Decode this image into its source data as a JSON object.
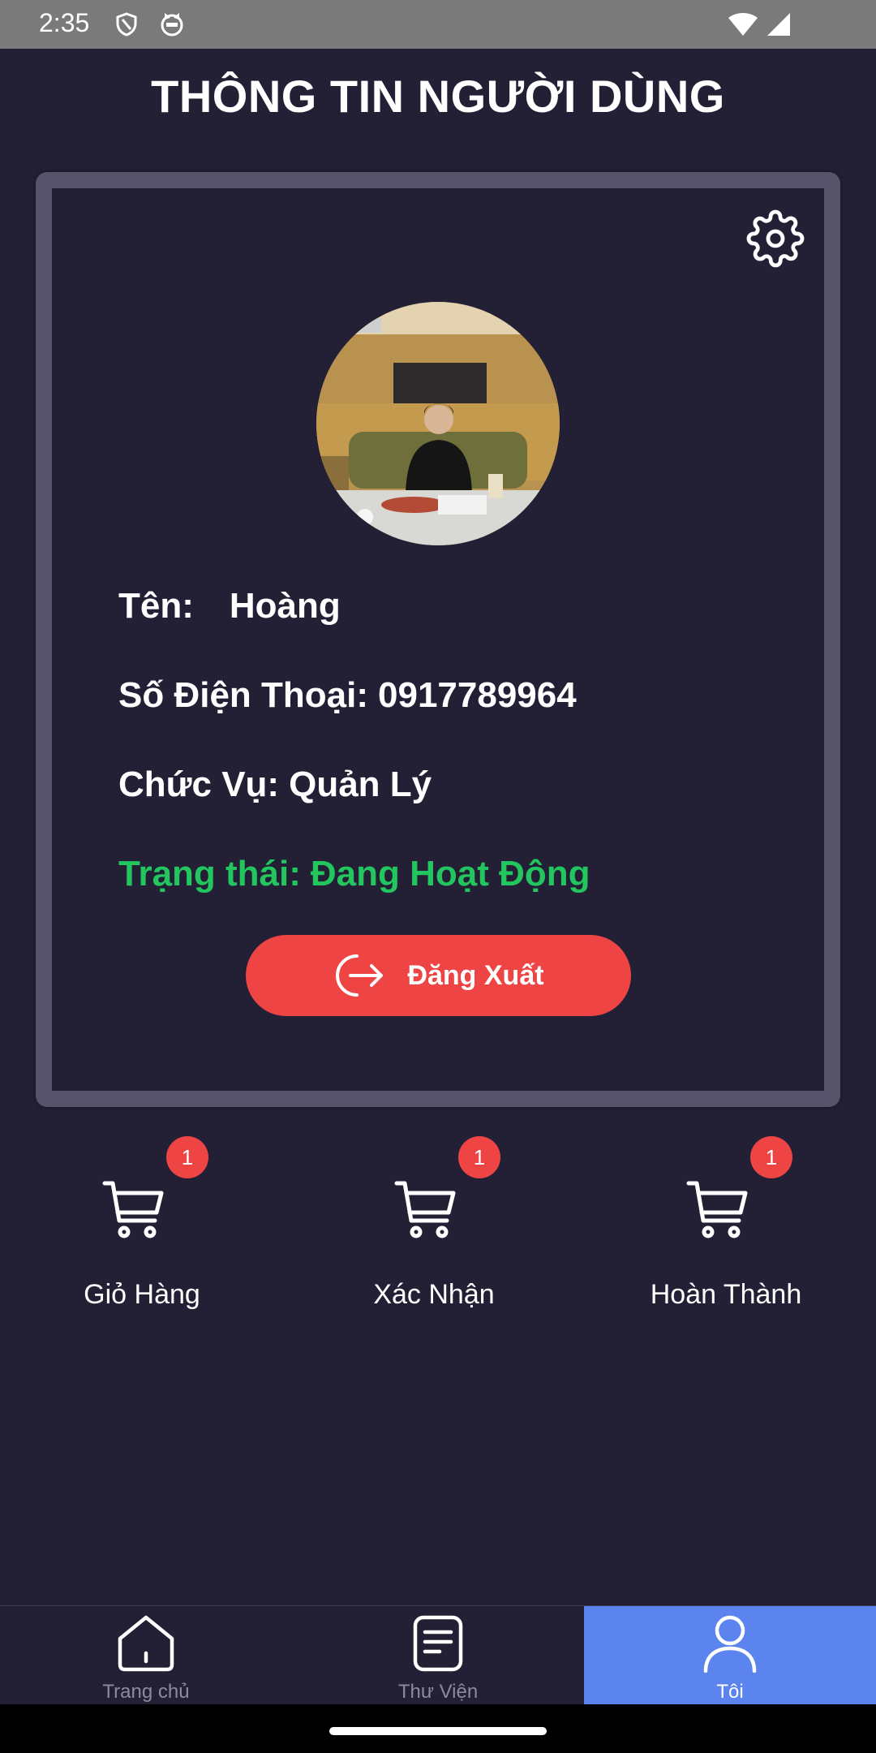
{
  "status_bar": {
    "time": "2:35",
    "icons": [
      "shield-icon",
      "cat-icon",
      "wifi-icon",
      "signal-icon"
    ]
  },
  "header": {
    "title": "THÔNG TIN NGƯỜI DÙNG"
  },
  "profile": {
    "name_label": "Tên:",
    "name_value": "Hoàng",
    "phone_label": "Số Điện Thoại:",
    "phone_value": "0917789964",
    "role_label": "Chức Vụ:",
    "role_value": "Quản Lý",
    "status_label": "Trạng thái:",
    "status_value": "Đang Hoạt Động",
    "status_color": "#22c55e",
    "logout_label": "Đăng Xuất",
    "logout_color": "#ef4444"
  },
  "orders": [
    {
      "label": "Giỏ Hàng",
      "badge": "1",
      "icon": "cart-icon"
    },
    {
      "label": "Xác Nhận",
      "badge": "1",
      "icon": "cart-icon"
    },
    {
      "label": "Hoàn Thành",
      "badge": "1",
      "icon": "cart-icon"
    }
  ],
  "bottom_nav": {
    "items": [
      {
        "label": "Trang chủ",
        "icon": "home-icon"
      },
      {
        "label": "Thư Viện",
        "icon": "library-icon"
      },
      {
        "label": "Tôi",
        "icon": "user-icon",
        "active": true
      }
    ],
    "active_color": "#5b84ef"
  },
  "colors": {
    "background": "#232036",
    "accent": "#5b84ef",
    "badge": "#ef4444"
  }
}
